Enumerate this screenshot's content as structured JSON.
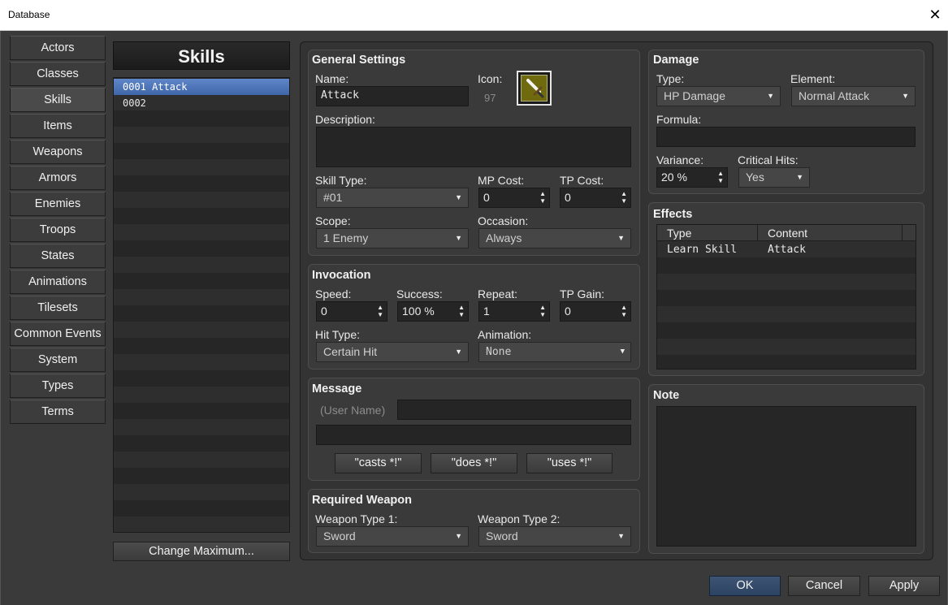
{
  "window": {
    "title": "Database",
    "close_glyph": "✕"
  },
  "tabs": [
    "Actors",
    "Classes",
    "Skills",
    "Items",
    "Weapons",
    "Armors",
    "Enemies",
    "Troops",
    "States",
    "Animations",
    "Tilesets",
    "Common Events",
    "System",
    "Types",
    "Terms"
  ],
  "active_tab": "Skills",
  "list": {
    "header": "Skills",
    "items": [
      "0001 Attack",
      "0002"
    ],
    "selected_index": 0,
    "change_max_label": "Change Maximum..."
  },
  "general": {
    "title": "General Settings",
    "name_label": "Name:",
    "name_value": "Attack",
    "icon_label": "Icon:",
    "icon_index": "97",
    "icon_name": "sword-icon",
    "description_label": "Description:",
    "description_value": "",
    "skill_type_label": "Skill Type:",
    "skill_type_value": "#01",
    "mp_cost_label": "MP Cost:",
    "mp_cost_value": "0",
    "tp_cost_label": "TP Cost:",
    "tp_cost_value": "0",
    "scope_label": "Scope:",
    "scope_value": "1 Enemy",
    "occasion_label": "Occasion:",
    "occasion_value": "Always"
  },
  "invocation": {
    "title": "Invocation",
    "speed_label": "Speed:",
    "speed_value": "0",
    "success_label": "Success:",
    "success_value": "100 %",
    "repeat_label": "Repeat:",
    "repeat_value": "1",
    "tp_gain_label": "TP Gain:",
    "tp_gain_value": "0",
    "hit_type_label": "Hit Type:",
    "hit_type_value": "Certain Hit",
    "animation_label": "Animation:",
    "animation_value": "None"
  },
  "message": {
    "title": "Message",
    "user_name_label": "(User Name)",
    "line1_value": "",
    "line2_value": "",
    "casts_label": "\"casts *!\"",
    "does_label": "\"does *!\"",
    "uses_label": "\"uses *!\""
  },
  "weapon": {
    "title": "Required Weapon",
    "type1_label": "Weapon Type 1:",
    "type1_value": "Sword",
    "type2_label": "Weapon Type 2:",
    "type2_value": "Sword"
  },
  "damage": {
    "title": "Damage",
    "type_label": "Type:",
    "type_value": "HP Damage",
    "element_label": "Element:",
    "element_value": "Normal Attack",
    "formula_label": "Formula:",
    "formula_value": "",
    "variance_label": "Variance:",
    "variance_value": "20 %",
    "critical_label": "Critical Hits:",
    "critical_value": "Yes"
  },
  "effects": {
    "title": "Effects",
    "columns": [
      "Type",
      "Content"
    ],
    "rows": [
      {
        "type": "Learn Skill",
        "content": "Attack"
      }
    ]
  },
  "note": {
    "title": "Note",
    "value": ""
  },
  "footer": {
    "ok": "OK",
    "cancel": "Cancel",
    "apply": "Apply"
  },
  "colors": {
    "accent_selection": "#4f76b8",
    "ok_button": "#34496a",
    "icon_bg": "#6f6a0e"
  }
}
